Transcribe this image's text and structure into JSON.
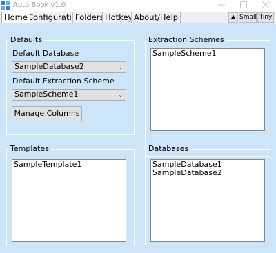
{
  "window": {
    "title": "Auto Book v1.0"
  },
  "tabs": [
    {
      "label": "Home",
      "active": true
    },
    {
      "label": "Configuration",
      "active": false
    },
    {
      "label": "Folders",
      "active": false
    },
    {
      "label": "Hotkeys",
      "active": false
    },
    {
      "label": "About/Help",
      "active": false
    }
  ],
  "view_buttons": {
    "up": "▲",
    "small": "Small",
    "tiny": "Tiny"
  },
  "defaults": {
    "title": "Defaults",
    "database_label": "Default Database",
    "database_value": "SampleDatabase2",
    "scheme_label": "Default Extraction Scheme",
    "scheme_value": "SampleScheme1",
    "manage_columns_label": "Manage Columns"
  },
  "extraction_schemes": {
    "title": "Extraction Schemes",
    "items": [
      "SampleScheme1"
    ]
  },
  "templates": {
    "title": "Templates",
    "items": [
      "SampleTemplate1"
    ]
  },
  "databases": {
    "title": "Databases",
    "items": [
      "SampleDatabase1",
      "SampleDatabase2"
    ]
  },
  "colors": {
    "background": "#cce5f8",
    "group_border": "#ffffff",
    "control_face": "#e1e1e1"
  }
}
